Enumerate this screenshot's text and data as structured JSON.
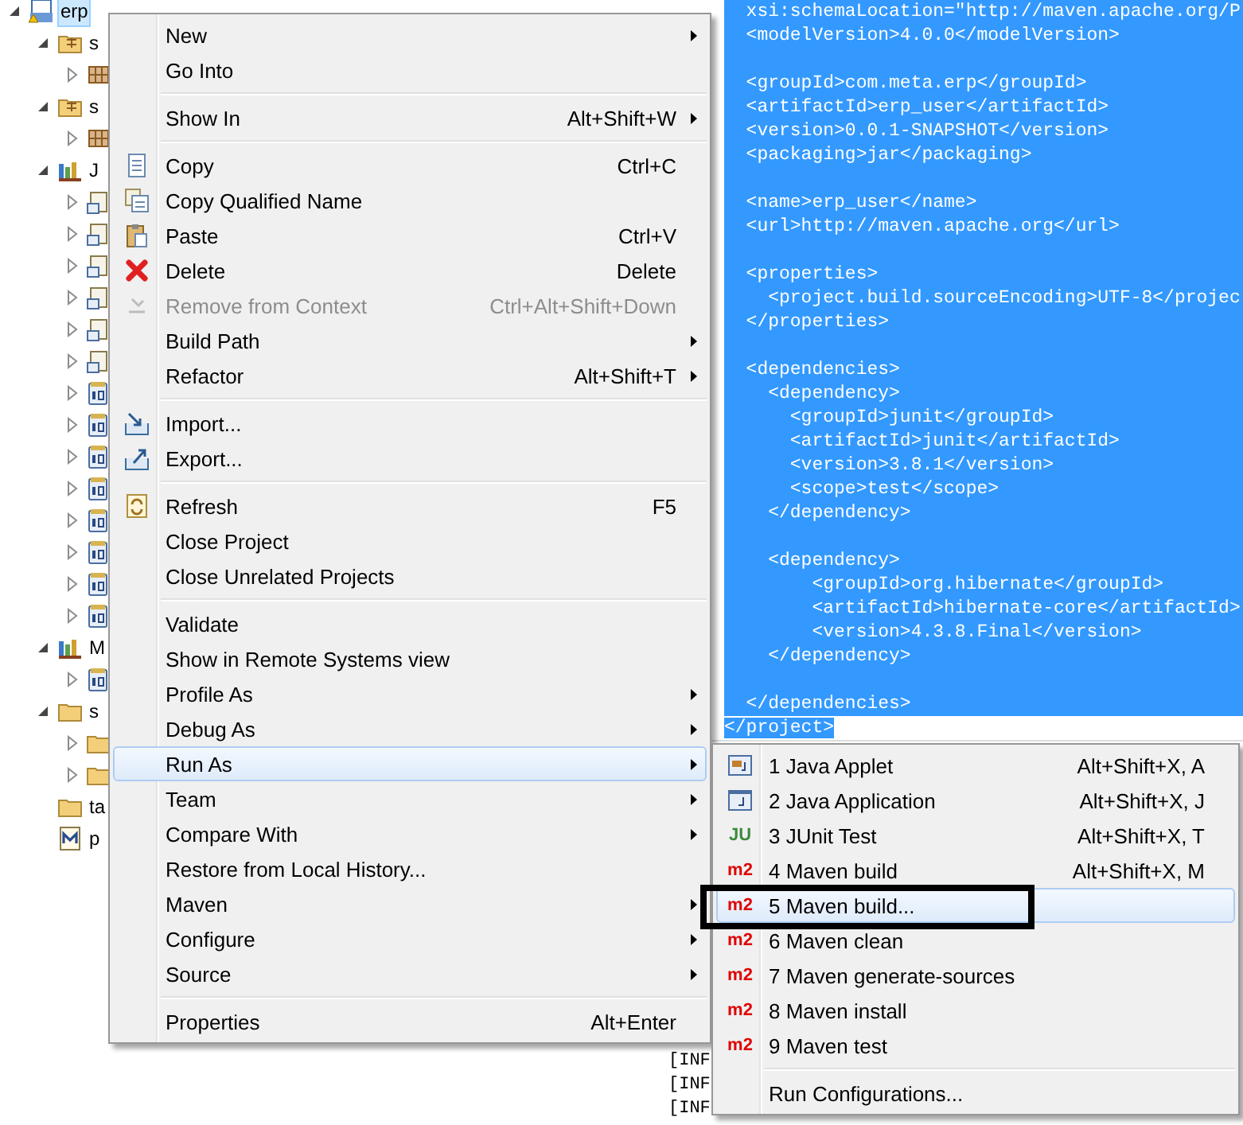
{
  "tree": {
    "items": [
      {
        "label": "erp",
        "kind": "project",
        "selected": true,
        "expanded": true,
        "children": [
          {
            "label": "s",
            "kind": "source-folder",
            "selected": false,
            "expanded": true,
            "children": [
              {
                "kind": "package",
                "selected": false,
                "expanded": false
              }
            ]
          },
          {
            "label": "s",
            "kind": "source-folder",
            "selected": false,
            "expanded": true,
            "children": [
              {
                "kind": "package",
                "selected": false,
                "expanded": false
              }
            ]
          },
          {
            "label": "J",
            "kind": "library",
            "selected": false,
            "expanded": true,
            "children": [
              {
                "kind": "jar",
                "selected": false,
                "expanded": false
              },
              {
                "kind": "jar",
                "selected": false,
                "expanded": false
              },
              {
                "kind": "jar",
                "selected": false,
                "expanded": false
              },
              {
                "kind": "jar",
                "selected": false,
                "expanded": false
              },
              {
                "kind": "jar",
                "selected": false,
                "expanded": false
              },
              {
                "kind": "jar",
                "selected": false,
                "expanded": false
              },
              {
                "kind": "binary",
                "selected": false,
                "expanded": false
              },
              {
                "kind": "binary",
                "selected": false,
                "expanded": false
              },
              {
                "kind": "binary",
                "selected": false,
                "expanded": false
              },
              {
                "kind": "binary",
                "selected": false,
                "expanded": false
              },
              {
                "kind": "binary",
                "selected": false,
                "expanded": false
              },
              {
                "kind": "binary",
                "selected": false,
                "expanded": false
              },
              {
                "kind": "binary",
                "selected": false,
                "expanded": false
              },
              {
                "kind": "binary",
                "selected": false,
                "expanded": false
              }
            ]
          },
          {
            "label": "M",
            "kind": "library",
            "selected": false,
            "expanded": true,
            "children": [
              {
                "kind": "binary",
                "selected": false,
                "expanded": false
              }
            ]
          },
          {
            "label": "s",
            "kind": "folder",
            "selected": false,
            "expanded": true,
            "children": [
              {
                "kind": "folder",
                "selected": false,
                "expanded": false
              },
              {
                "kind": "folder",
                "selected": false,
                "expanded": false
              }
            ]
          },
          {
            "label": "ta",
            "kind": "folder",
            "selected": false
          },
          {
            "label": "p",
            "kind": "pom",
            "selected": false
          }
        ]
      }
    ]
  },
  "editor": {
    "lines": [
      {
        "text": "  xsi:schemaLocation=\"http://maven.apache.org/P",
        "selected": true
      },
      {
        "text": "  <modelVersion>4.0.0</modelVersion>",
        "selected": true
      },
      {
        "selected": true
      },
      {
        "text": "  <groupId>com.meta.erp</groupId>",
        "selected": true
      },
      {
        "text": "  <artifactId>erp_user</artifactId>",
        "selected": true
      },
      {
        "text": "  <version>0.0.1-SNAPSHOT</version>",
        "selected": true
      },
      {
        "text": "  <packaging>jar</packaging>",
        "selected": true
      },
      {
        "selected": true
      },
      {
        "text": "  <name>erp_user</name>",
        "selected": true
      },
      {
        "text": "  <url>http://maven.apache.org</url>",
        "selected": true
      },
      {
        "selected": true
      },
      {
        "text": "  <properties>",
        "selected": true
      },
      {
        "text": "    <project.build.sourceEncoding>UTF-8</projec",
        "selected": true
      },
      {
        "text": "  </properties>",
        "selected": true
      },
      {
        "selected": true
      },
      {
        "text": "  <dependencies>",
        "selected": true
      },
      {
        "text": "    <dependency>",
        "selected": true
      },
      {
        "text": "      <groupId>junit</groupId>",
        "selected": true
      },
      {
        "text": "      <artifactId>junit</artifactId>",
        "selected": true
      },
      {
        "text": "      <version>3.8.1</version>",
        "selected": true
      },
      {
        "text": "      <scope>test</scope>",
        "selected": true
      },
      {
        "text": "    </dependency>",
        "selected": true
      },
      {
        "selected": true
      },
      {
        "text": "    <dependency>",
        "selected": true
      },
      {
        "text": "        <groupId>org.hibernate</groupId>",
        "selected": true
      },
      {
        "text": "        <artifactId>hibernate-core</artifactId>",
        "selected": true
      },
      {
        "text": "        <version>4.3.8.Final</version>",
        "selected": true
      },
      {
        "text": "    </dependency>",
        "selected": true
      },
      {
        "selected": true
      },
      {
        "text": "  </dependencies>",
        "selected": true
      },
      {
        "text": "</project>",
        "selected": true
      }
    ]
  },
  "console": {
    "lines": [
      "[INF",
      "[INF",
      "[INF"
    ]
  },
  "context_menu": {
    "items": [
      {
        "kind": "plain",
        "label": "New",
        "submenu": true,
        "selected": false,
        "disabled": false
      },
      {
        "kind": "plain",
        "label": "Go Into",
        "submenu": false,
        "selected": false,
        "disabled": false
      },
      {
        "kind": "separator"
      },
      {
        "kind": "plain",
        "label": "Show In",
        "shortcut": "Alt+Shift+W",
        "submenu": true,
        "selected": false,
        "disabled": false
      },
      {
        "kind": "separator"
      },
      {
        "kind": "copy",
        "label": "Copy",
        "shortcut": "Ctrl+C",
        "submenu": false,
        "selected": false,
        "disabled": false
      },
      {
        "kind": "copy-name",
        "label": "Copy Qualified Name",
        "submenu": false,
        "selected": false,
        "disabled": false
      },
      {
        "kind": "paste",
        "label": "Paste",
        "shortcut": "Ctrl+V",
        "submenu": false,
        "selected": false,
        "disabled": false
      },
      {
        "kind": "delete",
        "label": "Delete",
        "shortcut": "Delete",
        "submenu": false,
        "selected": false,
        "disabled": false
      },
      {
        "kind": "remove",
        "label": "Remove from Context",
        "shortcut": "Ctrl+Alt+Shift+Down",
        "submenu": false,
        "selected": false,
        "disabled": true
      },
      {
        "kind": "plain",
        "label": "Build Path",
        "submenu": true,
        "selected": false,
        "disabled": false
      },
      {
        "kind": "plain",
        "label": "Refactor",
        "shortcut": "Alt+Shift+T",
        "submenu": true,
        "selected": false,
        "disabled": false
      },
      {
        "kind": "separator"
      },
      {
        "kind": "import",
        "label": "Import...",
        "submenu": false,
        "selected": false,
        "disabled": false
      },
      {
        "kind": "export",
        "label": "Export...",
        "submenu": false,
        "selected": false,
        "disabled": false
      },
      {
        "kind": "separator"
      },
      {
        "kind": "refresh",
        "label": "Refresh",
        "shortcut": "F5",
        "submenu": false,
        "selected": false,
        "disabled": false
      },
      {
        "kind": "plain",
        "label": "Close Project",
        "submenu": false,
        "selected": false,
        "disabled": false
      },
      {
        "kind": "plain",
        "label": "Close Unrelated Projects",
        "submenu": false,
        "selected": false,
        "disabled": false
      },
      {
        "kind": "separator"
      },
      {
        "kind": "plain",
        "label": "Validate",
        "submenu": false,
        "selected": false,
        "disabled": false
      },
      {
        "kind": "plain",
        "label": "Show in Remote Systems view",
        "submenu": false,
        "selected": false,
        "disabled": false
      },
      {
        "kind": "plain",
        "label": "Profile As",
        "submenu": true,
        "selected": false,
        "disabled": false
      },
      {
        "kind": "plain",
        "label": "Debug As",
        "submenu": true,
        "selected": false,
        "disabled": false
      },
      {
        "kind": "plain",
        "label": "Run As",
        "submenu": true,
        "selected": true,
        "disabled": false
      },
      {
        "kind": "plain",
        "label": "Team",
        "submenu": true,
        "selected": false,
        "disabled": false
      },
      {
        "kind": "plain",
        "label": "Compare With",
        "submenu": true,
        "selected": false,
        "disabled": false
      },
      {
        "kind": "plain",
        "label": "Restore from Local History...",
        "submenu": false,
        "selected": false,
        "disabled": false
      },
      {
        "kind": "plain",
        "label": "Maven",
        "submenu": true,
        "selected": false,
        "disabled": false
      },
      {
        "kind": "plain",
        "label": "Configure",
        "submenu": true,
        "selected": false,
        "disabled": false
      },
      {
        "kind": "plain",
        "label": "Source",
        "submenu": true,
        "selected": false,
        "disabled": false
      },
      {
        "kind": "separator"
      },
      {
        "kind": "plain",
        "label": "Properties",
        "shortcut": "Alt+Enter",
        "submenu": false,
        "selected": false,
        "disabled": false
      }
    ]
  },
  "run_as_menu": {
    "items": [
      {
        "kind": "applet",
        "label": "1 Java Applet",
        "shortcut": "Alt+Shift+X, A",
        "selected": false,
        "framed": false
      },
      {
        "kind": "application",
        "label": "2 Java Application",
        "shortcut": "Alt+Shift+X, J",
        "selected": false,
        "framed": false
      },
      {
        "kind": "junit",
        "label": "3 JUnit Test",
        "shortcut": "Alt+Shift+X, T",
        "badge": "JU",
        "selected": false,
        "framed": false
      },
      {
        "kind": "maven",
        "label": "4 Maven build",
        "shortcut": "Alt+Shift+X, M",
        "badge": "m2",
        "selected": false,
        "framed": false
      },
      {
        "kind": "maven",
        "label": "5 Maven build...",
        "badge": "m2",
        "selected": true,
        "framed": true
      },
      {
        "kind": "maven",
        "label": "6 Maven clean",
        "badge": "m2",
        "selected": false,
        "framed": false
      },
      {
        "kind": "maven",
        "label": "7 Maven generate-sources",
        "badge": "m2",
        "selected": false,
        "framed": false
      },
      {
        "kind": "maven",
        "label": "8 Maven install",
        "badge": "m2",
        "selected": false,
        "framed": false
      },
      {
        "kind": "maven",
        "label": "9 Maven test",
        "badge": "m2",
        "selected": false,
        "framed": false
      },
      {
        "kind": "separator"
      },
      {
        "kind": "plain",
        "label": "Run Configurations...",
        "selected": false,
        "framed": false
      }
    ]
  }
}
